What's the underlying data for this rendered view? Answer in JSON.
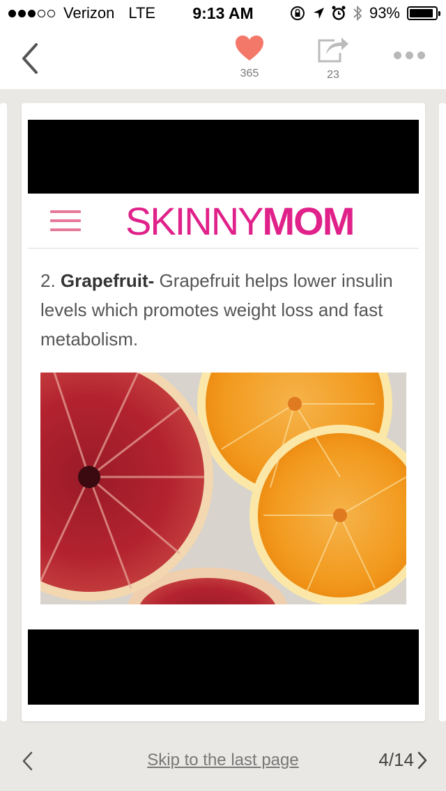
{
  "status": {
    "carrier": "Verizon",
    "network": "LTE",
    "time": "9:13 AM",
    "battery": "93%",
    "battery_level": 0.93,
    "signal_bars": 3
  },
  "nav": {
    "likes": "365",
    "shares": "23",
    "icons": {
      "back": "chevron-left-icon",
      "like": "heart-icon",
      "share": "share-icon",
      "more": "more-dots-icon"
    },
    "like_color": "#f4786a"
  },
  "card": {
    "logo_light": "SKINNY",
    "logo_bold": "MOM",
    "brand_color": "#e0218a",
    "article_number": "2.",
    "article_title": "Grapefruit-",
    "article_body": " Grapefruit helps lower insulin levels which promotes weight loss and fast metabolism."
  },
  "footer": {
    "skip_label": "Skip to the last page",
    "page_indicator": "4/14"
  }
}
